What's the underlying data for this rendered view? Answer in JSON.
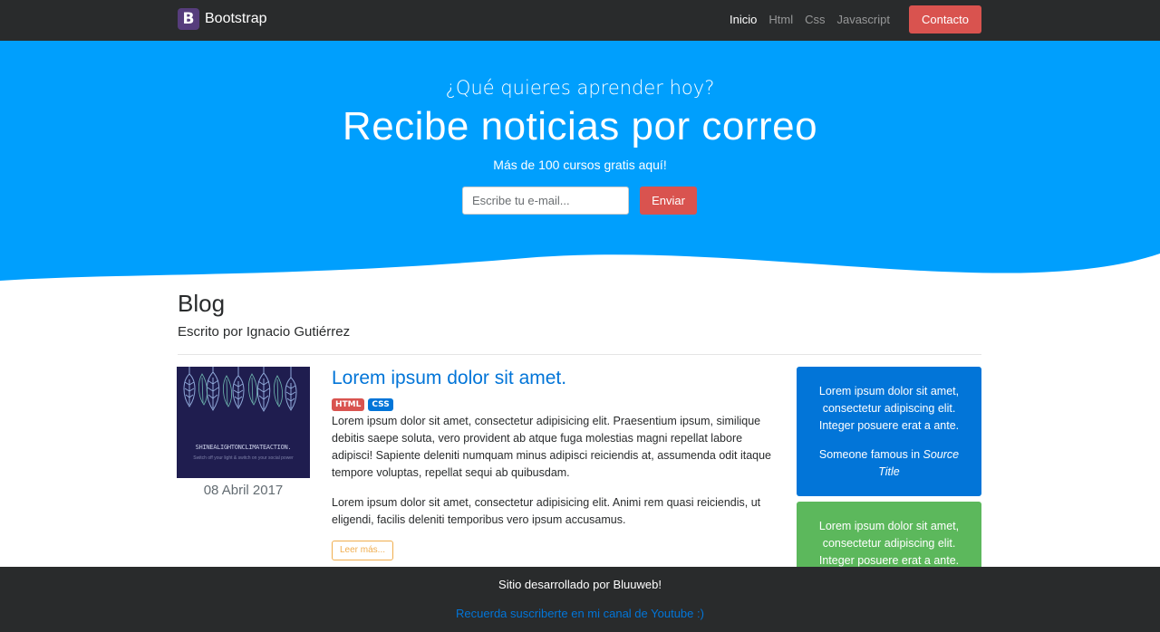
{
  "colors": {
    "navbar_bg": "#292b2c",
    "hero_bg": "#009ffd",
    "primary": "#0275d8",
    "danger": "#d9534f",
    "success": "#5cb85c",
    "warning": "#f0ad4e",
    "brand": "#563d7c"
  },
  "navbar": {
    "brand_logo": "B",
    "brand_name": "Bootstrap",
    "links": [
      "Inicio",
      "Html",
      "Css",
      "Javascript"
    ],
    "active_link": "Inicio",
    "contact_label": "Contacto"
  },
  "hero": {
    "question": "¿Qué quieres aprender hoy?",
    "title": "Recibe noticias por correo",
    "lead": "Más de 100 cursos gratis aquí!",
    "email_placeholder": "Escribe tu e-mail...",
    "send_label": "Enviar"
  },
  "blog": {
    "title": "Blog",
    "author": "Escrito por Ignacio Gutiérrez"
  },
  "post": {
    "image_text": "SHINEALIGHTONCLIMATEACTION.",
    "image_subtext": "Switch off your light & switch on your social power",
    "date": "08 Abril 2017",
    "title": "Lorem ipsum dolor sit amet.",
    "badges": [
      "HTML",
      "CSS"
    ],
    "paragraph1": "Lorem ipsum dolor sit amet, consectetur adipisicing elit. Praesentium ipsum, similique debitis saepe soluta, vero provident ab atque fuga molestias magni repellat labore adipisci! Sapiente deleniti numquam minus adipisci reiciendis at, assumenda odit itaque tempore voluptas, repellat sequi ab quibusdam.",
    "paragraph2": "Lorem ipsum dolor sit amet, consectetur adipisicing elit. Animi rem quasi reiciendis, ut eligendi, facilis deleniti temporibus vero ipsum accusamus.",
    "read_more_label": "Leer más..."
  },
  "side_cards": [
    {
      "text": "Lorem ipsum dolor sit amet, consectetur adipiscing elit. Integer posuere erat a ante.",
      "cite_prefix": "Someone famous in ",
      "cite_source": "Source Title"
    },
    {
      "text": "Lorem ipsum dolor sit amet, consectetur adipiscing elit. Integer posuere erat a ante."
    }
  ],
  "footer": {
    "line1": "Sitio desarrollado por Bluuweb!",
    "line2": "Recuerda suscriberte en mi canal de Youtube :)"
  }
}
